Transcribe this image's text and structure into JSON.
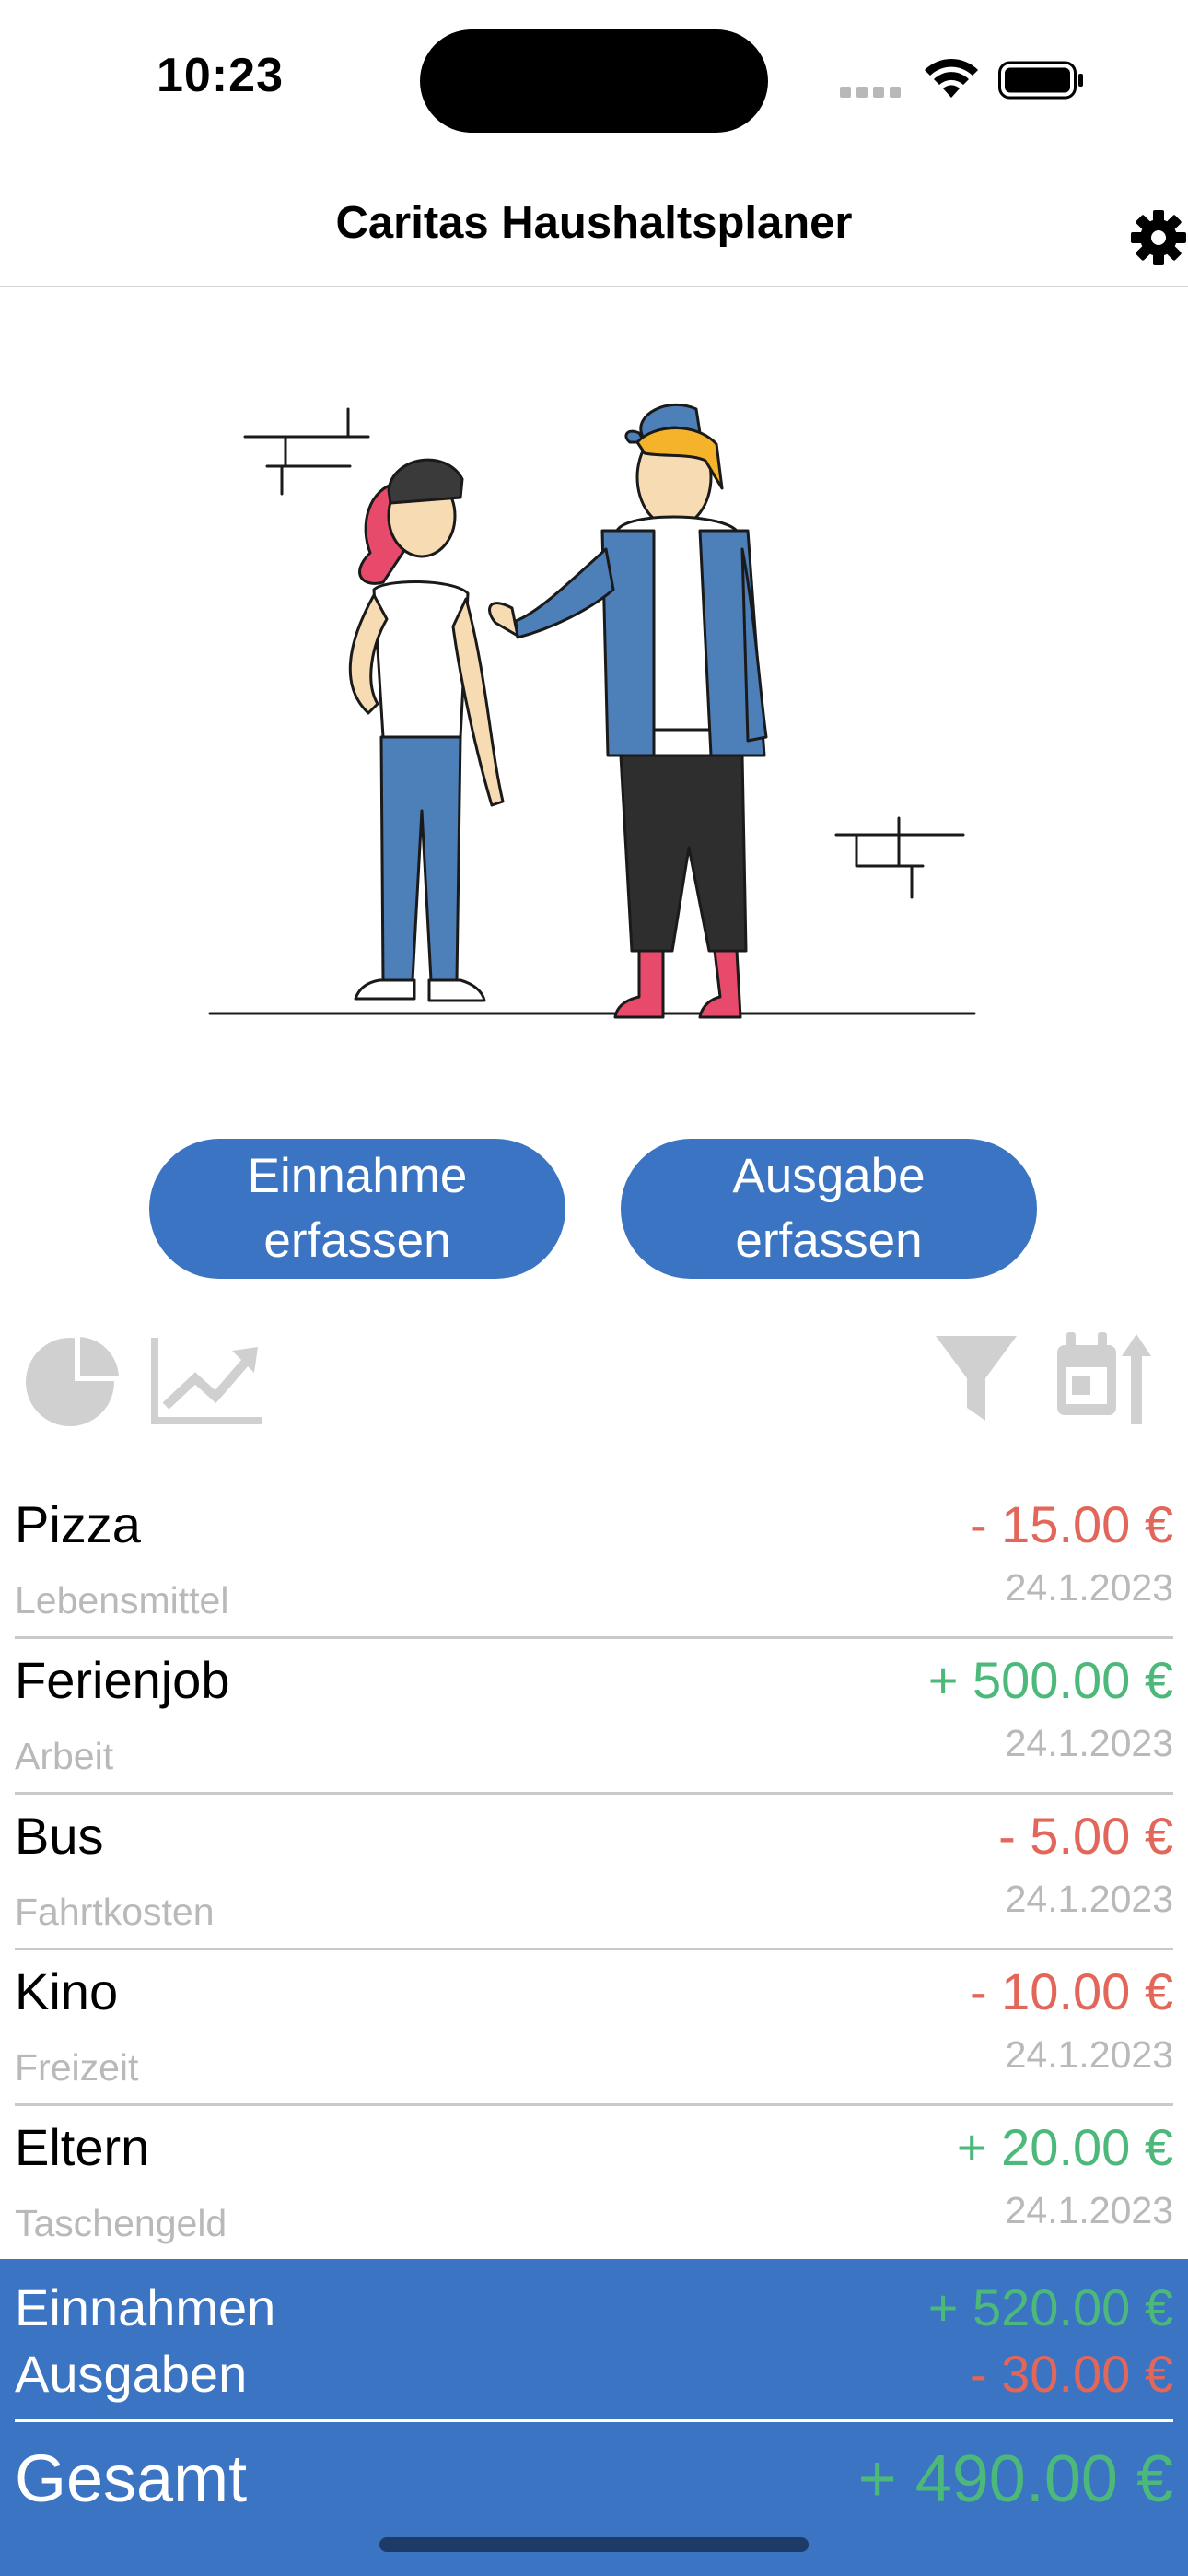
{
  "status_bar": {
    "time": "10:23"
  },
  "header": {
    "title": "Caritas Haushaltsplaner"
  },
  "actions": {
    "income_button": "Einnahme\nerfassen",
    "expense_button": "Ausgabe\nerfassen"
  },
  "toolbar": {
    "icons": [
      "pie-chart-icon",
      "line-chart-icon",
      "filter-icon",
      "calendar-sort-icon"
    ]
  },
  "transactions": [
    {
      "title": "Pizza",
      "category": "Lebensmittel",
      "amount": "- 15.00 €",
      "date": "24.1.2023",
      "type": "expense"
    },
    {
      "title": "Ferienjob",
      "category": "Arbeit",
      "amount": "+ 500.00 €",
      "date": "24.1.2023",
      "type": "income"
    },
    {
      "title": "Bus",
      "category": "Fahrtkosten",
      "amount": "- 5.00 €",
      "date": "24.1.2023",
      "type": "expense"
    },
    {
      "title": "Kino",
      "category": "Freizeit",
      "amount": "- 10.00 €",
      "date": "24.1.2023",
      "type": "expense"
    },
    {
      "title": "Eltern",
      "category": "Taschengeld",
      "amount": "+ 20.00 €",
      "date": "24.1.2023",
      "type": "income"
    }
  ],
  "summary": {
    "income_label": "Einnahmen",
    "income_value": "+ 520.00 €",
    "expense_label": "Ausgaben",
    "expense_value": "- 30.00 €",
    "total_label": "Gesamt",
    "total_value": "+ 490.00 €"
  },
  "colors": {
    "accent": "#3a74c2",
    "expense": "#e2675a",
    "income": "#4cb87a",
    "muted": "#b9b9b9"
  }
}
